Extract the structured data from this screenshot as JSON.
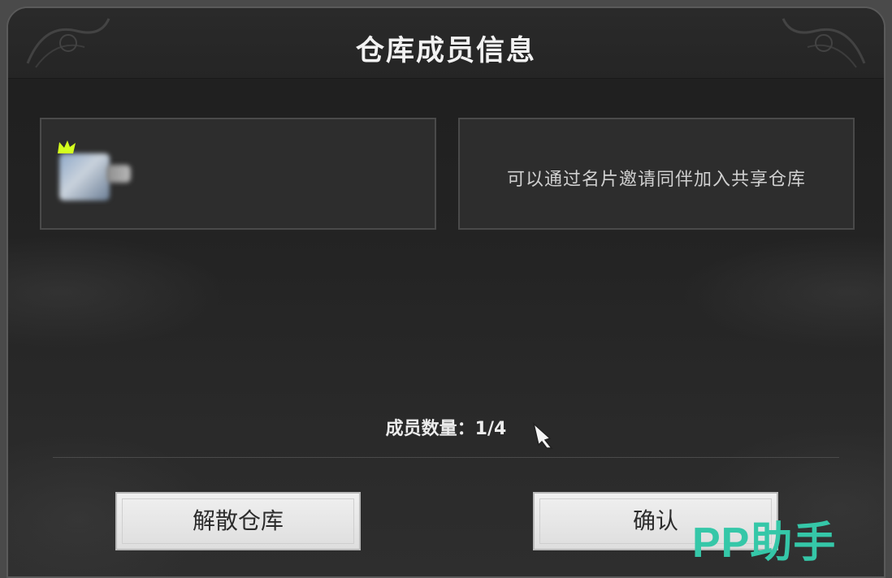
{
  "dialog": {
    "title": "仓库成员信息"
  },
  "members": [
    {
      "slot": "owner",
      "avatar_icon": "blurred-avatar",
      "badge_icon": "crown-icon",
      "badge_color": "#d4ff1e"
    }
  ],
  "invite_card": {
    "text": "可以通过名片邀请同伴加入共享仓库"
  },
  "member_count": {
    "text": "成员数量：1/4",
    "current": 1,
    "max": 4
  },
  "buttons": {
    "disband_label": "解散仓库",
    "confirm_label": "确认"
  },
  "watermark": {
    "text": "PP助手",
    "color": "#35c7a8"
  }
}
